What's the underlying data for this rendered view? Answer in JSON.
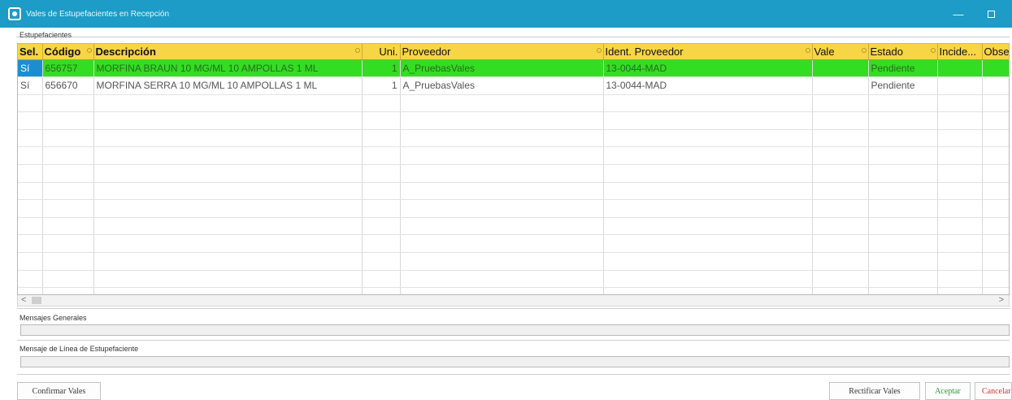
{
  "window": {
    "title": "Vales de Estupefacientes en Recepción",
    "min_glyph": "—"
  },
  "group": {
    "label": "Estupefacientes"
  },
  "grid": {
    "columns": [
      "Sel.",
      "Código",
      "Descripción",
      "Uni.",
      "Proveedor",
      "Ident. Proveedor",
      "Vale",
      "Estado",
      "Incide...",
      "Obse"
    ],
    "rows": [
      {
        "sel": "Sí",
        "codigo": "656757",
        "descripcion": "MORFINA BRAUN 10 MG/ML 10 AMPOLLAS 1 ML",
        "uni": "1",
        "proveedor": "A_PruebasVales",
        "ident": "13-0044-MAD",
        "vale": "",
        "estado": "Pendiente",
        "incide": "",
        "obse": ""
      },
      {
        "sel": "Sí",
        "codigo": "656670",
        "descripcion": "MORFINA SERRA 10 MG/ML 10 AMPOLLAS 1 ML",
        "uni": "1",
        "proveedor": "A_PruebasVales",
        "ident": "13-0044-MAD",
        "vale": "",
        "estado": "Pendiente",
        "incide": "",
        "obse": ""
      }
    ],
    "selected_row_color": "#33dd22",
    "selected_cell_color": "#1a8fd0",
    "header_color": "#f7d544"
  },
  "scrollbar": {
    "left_glyph": "<",
    "right_glyph": ">"
  },
  "panels": {
    "general_label": "Mensajes Generales",
    "general_value": "",
    "line_label": "Mensaje de Línea de Estupefaciente",
    "line_value": ""
  },
  "buttons": {
    "confirm": "Confirmar Vales",
    "rectify": "Rectificar Vales",
    "accept": "Aceptar",
    "cancel": "Cancelar"
  },
  "colors": {
    "titlebar": "#1c9cc6"
  }
}
